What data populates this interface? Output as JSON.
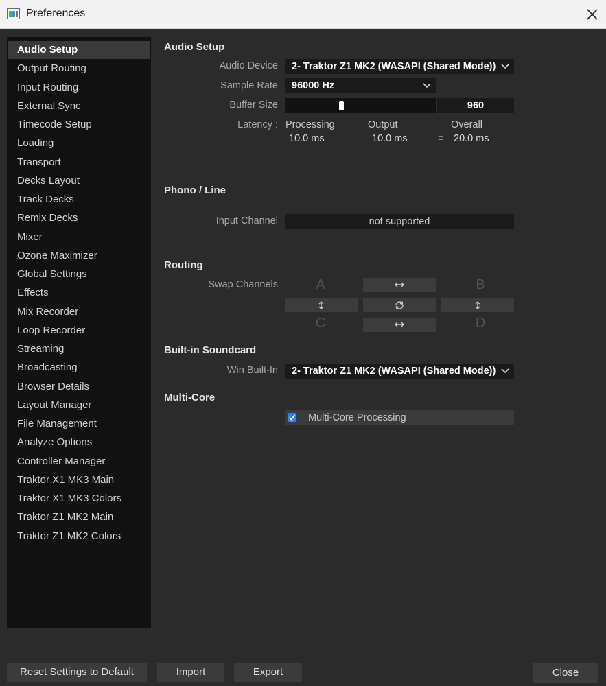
{
  "window": {
    "title": "Preferences"
  },
  "sidebar": {
    "items": [
      {
        "label": "Audio Setup",
        "active": true
      },
      {
        "label": "Output Routing"
      },
      {
        "label": "Input Routing"
      },
      {
        "label": "External Sync"
      },
      {
        "label": "Timecode Setup"
      },
      {
        "label": "Loading"
      },
      {
        "label": "Transport"
      },
      {
        "label": "Decks Layout"
      },
      {
        "label": "Track Decks"
      },
      {
        "label": "Remix Decks"
      },
      {
        "label": "Mixer"
      },
      {
        "label": "Ozone Maximizer"
      },
      {
        "label": "Global Settings"
      },
      {
        "label": "Effects"
      },
      {
        "label": "Mix Recorder"
      },
      {
        "label": "Loop Recorder"
      },
      {
        "label": "Streaming"
      },
      {
        "label": "Broadcasting"
      },
      {
        "label": "Browser Details"
      },
      {
        "label": "Layout Manager"
      },
      {
        "label": "File Management"
      },
      {
        "label": "Analyze Options"
      },
      {
        "label": "Controller Manager"
      },
      {
        "label": "Traktor X1 MK3 Main"
      },
      {
        "label": "Traktor X1 MK3 Colors"
      },
      {
        "label": "Traktor Z1 MK2 Main"
      },
      {
        "label": "Traktor Z1 MK2 Colors"
      }
    ]
  },
  "audio_setup": {
    "heading": "Audio Setup",
    "audio_device_label": "Audio Device",
    "audio_device_value": "2- Traktor Z1 MK2 (WASAPI (Shared Mode))",
    "sample_rate_label": "Sample Rate",
    "sample_rate_value": "96000 Hz",
    "buffer_size_label": "Buffer Size",
    "buffer_size_value": "960",
    "buffer_slider_fraction": 0.37,
    "latency_label": "Latency :",
    "processing_label": "Processing",
    "processing_value": "10.0 ms",
    "output_label": "Output",
    "output_value": "10.0 ms",
    "equals": "=",
    "overall_label": "Overall",
    "overall_value": "20.0 ms"
  },
  "phono_line": {
    "heading": "Phono / Line",
    "input_channel_label": "Input Channel",
    "input_channel_value": "not supported"
  },
  "routing": {
    "heading": "Routing",
    "swap_channels_label": "Swap Channels",
    "letter_a": "A",
    "letter_b": "B",
    "letter_c": "C",
    "letter_d": "D"
  },
  "builtin_soundcard": {
    "heading": "Built-in Soundcard",
    "win_builtin_label": "Win Built-In",
    "win_builtin_value": "2- Traktor Z1 MK2 (WASAPI (Shared Mode))"
  },
  "multicore": {
    "heading": "Multi-Core",
    "checkbox_label": "Multi-Core Processing",
    "checked": true
  },
  "footer": {
    "reset_label": "Reset Settings to Default",
    "import_label": "Import",
    "export_label": "Export",
    "close_label": "Close"
  },
  "colors": {
    "background": "#2b2b2b",
    "sidebar": "#111111",
    "accent": "#2f7cf6"
  }
}
